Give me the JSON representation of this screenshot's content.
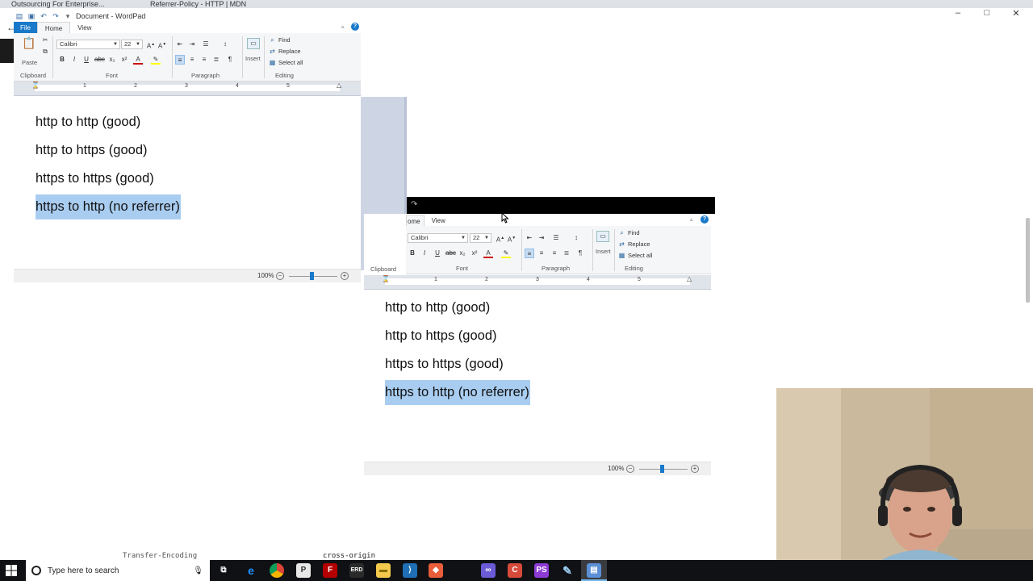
{
  "browser": {
    "tab1": "Outsourcing For Enterprise...",
    "tab2": "Referrer-Policy - HTTP | MDN",
    "controls": [
      "–",
      "□",
      "✕"
    ]
  },
  "wordpad_top": {
    "title": "Document - WordPad",
    "tabs": {
      "file": "File",
      "home": "Home",
      "view": "View"
    },
    "clipboard": {
      "paste": "Paste",
      "label": "Clipboard"
    },
    "font": {
      "family": "Calibri",
      "size": "22",
      "label": "Font"
    },
    "paragraph": {
      "label": "Paragraph"
    },
    "insert": {
      "label": "Insert"
    },
    "editing": {
      "find": "Find",
      "replace": "Replace",
      "select_all": "Select all",
      "label": "Editing"
    },
    "ruler_numbers": [
      "1",
      "2",
      "3",
      "4",
      "5"
    ],
    "lines": [
      "http to http (good)",
      "http to https (good)",
      "https to https (good)",
      "https to http (no referrer)"
    ],
    "zoom": "100%"
  },
  "wordpad_bottom": {
    "tabs": {
      "home": "ome",
      "view": "View"
    },
    "clipboard": {
      "label": "Clipboard"
    },
    "font": {
      "family": "Calibri",
      "size": "22",
      "label": "Font"
    },
    "paragraph": {
      "label": "Paragraph"
    },
    "insert": {
      "label": "Insert"
    },
    "editing": {
      "find": "Find",
      "replace": "Replace",
      "select_all": "Select all",
      "label": "Editing"
    },
    "ruler_numbers": [
      "1",
      "2",
      "3",
      "4",
      "5"
    ],
    "lines": [
      "http to http (good)",
      "http to https (good)",
      "https to https (good)",
      "https to http (no referrer)"
    ],
    "zoom": "100%"
  },
  "background_text": {
    "left": "Transfer-Encoding",
    "right": "cross-origin"
  },
  "taskbar": {
    "search_placeholder": "Type here to search",
    "apps": [
      "task-view",
      "edge",
      "chrome",
      "phpstorm",
      "filezilla",
      "heidisql",
      "file-explorer",
      "vscode",
      "git",
      "vs",
      "todoist",
      "phpstorm-alt",
      "paint",
      "wordpad"
    ]
  },
  "colors": {
    "accent": "#1979ca",
    "selection": "#a9cdf0",
    "taskbar": "#101114"
  }
}
